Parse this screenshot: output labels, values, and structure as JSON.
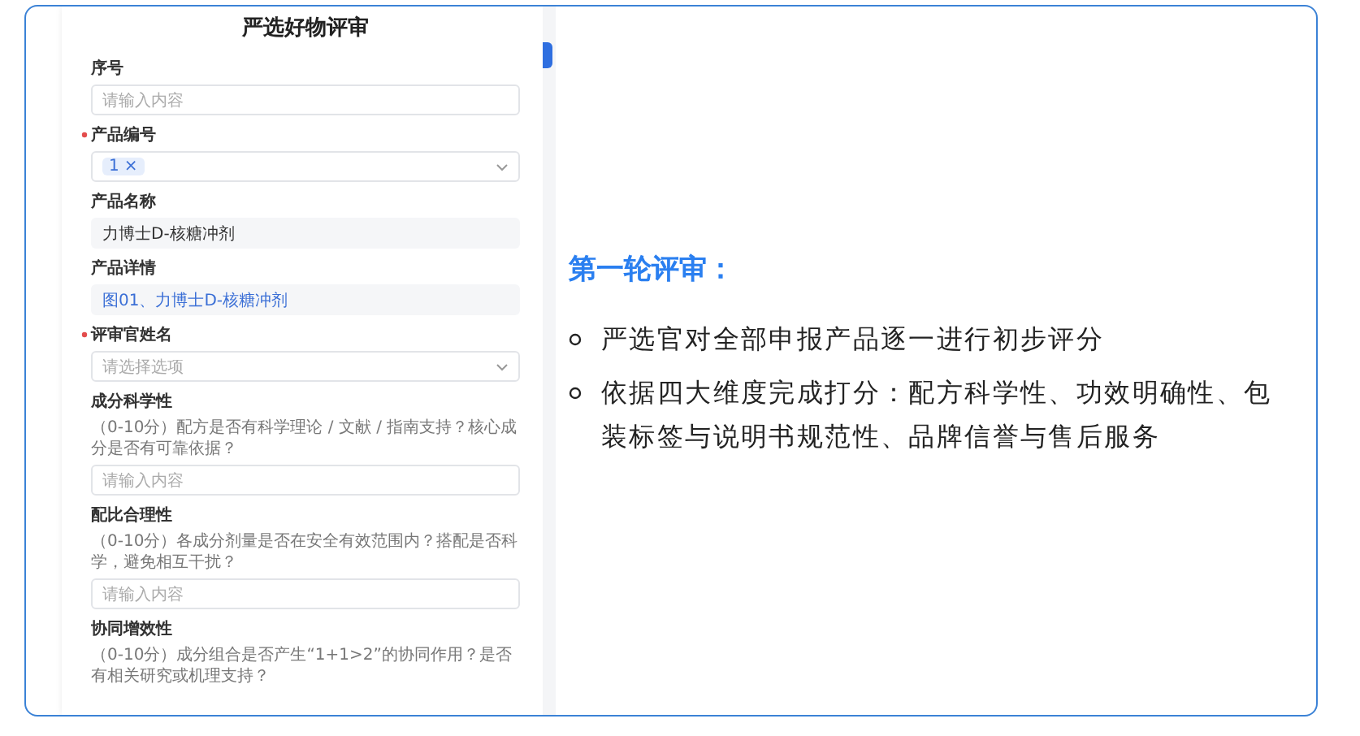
{
  "form": {
    "title": "严选好物评审",
    "fields": [
      {
        "kind": "input",
        "label": "序号",
        "required": false,
        "placeholder": "请输入内容"
      },
      {
        "kind": "tags",
        "label": "产品编号",
        "required": true,
        "tags": [
          "1"
        ],
        "tag_remove": "×"
      },
      {
        "kind": "text",
        "label": "产品名称",
        "required": false,
        "value": "力博士D-核糖冲剂"
      },
      {
        "kind": "link",
        "label": "产品详情",
        "required": false,
        "value": "图01、力博士D-核糖冲剂"
      },
      {
        "kind": "select",
        "label": "评审官姓名",
        "required": true,
        "placeholder": "请选择选项"
      },
      {
        "kind": "input",
        "label": "成分科学性",
        "required": false,
        "help": "（0-10分）配方是否有科学理论 / 文献 / 指南支持？核心成分是否有可靠依据？",
        "placeholder": "请输入内容"
      },
      {
        "kind": "input",
        "label": "配比合理性",
        "required": false,
        "help": "（0-10分）各成分剂量是否在安全有效范围内？搭配是否科学，避免相互干扰？",
        "placeholder": "请输入内容"
      },
      {
        "kind": "heading",
        "label": "协同增效性",
        "required": false,
        "help": "（0-10分）成分组合是否产生“1+1>2”的协同作用？是否有相关研究或机理支持？"
      }
    ]
  },
  "notes": {
    "heading": "第一轮评审：",
    "bullets": [
      "严选官对全部申报产品逐一进行初步评分",
      "依据四大维度完成打分：配方科学性、功效明确性、包装标签与说明书规范性、品牌信誉与售后服务"
    ]
  }
}
